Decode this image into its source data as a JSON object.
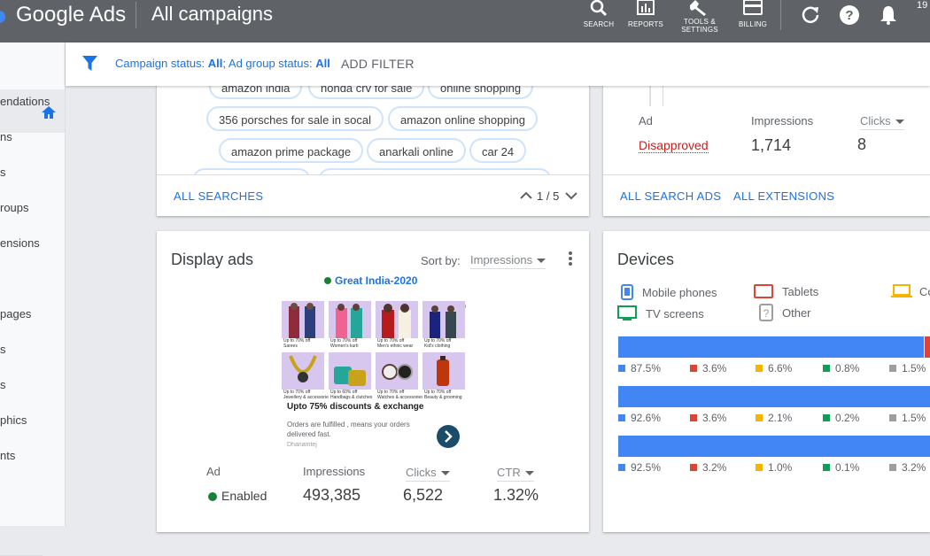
{
  "header": {
    "brand": "Google Ads",
    "title": "All campaigns",
    "tools": [
      {
        "label": "SEARCH",
        "icon": "search-icon"
      },
      {
        "label": "REPORTS",
        "icon": "reports-icon"
      },
      {
        "label_line1": "TOOLS &",
        "label_line2": "SETTINGS",
        "icon": "wrench-icon"
      },
      {
        "label": "BILLING",
        "icon": "billing-icon"
      }
    ],
    "account_fragment": "19"
  },
  "nav": {
    "items": [
      "endations",
      "ns",
      "s",
      "roups",
      "ensions",
      "pages",
      "s",
      "s",
      "phics",
      "nts"
    ]
  },
  "filter": {
    "campaign_label": "Campaign status: ",
    "campaign_value": "All",
    "sep": "; Ad group status: ",
    "adgroup_value": "All",
    "add_filter": "ADD FILTER"
  },
  "searches_card": {
    "chips": [
      {
        "text": "amazon india"
      },
      {
        "text": "honda crv for sale"
      },
      {
        "text": "online shopping"
      },
      {
        "text": "356 porsches for sale in socal"
      },
      {
        "text": "amazon online shopping"
      },
      {
        "text": "amazon prime package"
      },
      {
        "text": "anarkali online"
      },
      {
        "text": "car 24"
      }
    ],
    "link": "ALL SEARCHES",
    "pager": "1 / 5"
  },
  "search_ads_card": {
    "ad_label": "Ad",
    "status": "Disapproved",
    "impressions_label": "Impressions",
    "impressions": "1,714",
    "clicks_label": "Clicks",
    "clicks": "8",
    "link1": "ALL SEARCH ADS",
    "link2": "ALL EXTENSIONS"
  },
  "display_card": {
    "title": "Display ads",
    "sort_label": "Sort by:",
    "sort_value": "Impressions",
    "campaign": "Great India-2020",
    "ad": {
      "headline": "Upto 75% discounts & exchange",
      "body": "Orders are fulfilled , means your orders delivered fast.",
      "advertiser": "Dhanamtej",
      "thumb_captions": [
        "Up to 70% off",
        "Up to 70% off",
        "Up to 70% off",
        "Up to 70% off",
        "Up to 70% off",
        "Up to 60% off",
        "Up to 70% off",
        "Up to 70% off"
      ],
      "thumb_sub": [
        "Sarees",
        "Women's kurti",
        "Men's ethnic wear",
        "Kid's clothing",
        "Jewellery & accessories",
        "Handbags & clutches",
        "Watches & accessories",
        "Beauty & grooming"
      ]
    },
    "ad_label": "Ad",
    "status": "Enabled",
    "impressions_label": "Impressions",
    "impressions": "493,385",
    "clicks_label": "Clicks",
    "clicks": "6,522",
    "ctr_label": "CTR",
    "ctr": "1.32%"
  },
  "devices_card": {
    "title": "Devices",
    "legend": [
      {
        "label": "Mobile phones",
        "icon": "mobile-phone-icon"
      },
      {
        "label": "Tablets",
        "icon": "tablet-icon"
      },
      {
        "label": "Co",
        "icon": "computer-icon"
      },
      {
        "label": "TV screens",
        "icon": "tv-icon"
      },
      {
        "label": "Other",
        "icon": "other-device-icon"
      }
    ],
    "colors": {
      "mobile": "#4285f4",
      "tablet": "#db4437",
      "computer": "#f4b400",
      "tv": "#0f9d58",
      "other": "#9e9e9e"
    },
    "rows": [
      {
        "values": [
          87.5,
          3.6,
          6.6,
          0.8,
          1.5
        ],
        "labels": [
          "87.5%",
          "3.6%",
          "6.6%",
          "0.8%",
          "1.5%"
        ]
      },
      {
        "values": [
          92.6,
          3.6,
          2.1,
          0.2,
          1.5
        ],
        "labels": [
          "92.6%",
          "3.6%",
          "2.1%",
          "0.2%",
          "1.5%"
        ]
      },
      {
        "values": [
          92.5,
          3.2,
          1.0,
          0.1,
          3.2
        ],
        "labels": [
          "92.5%",
          "3.2%",
          "1.0%",
          "0.1%",
          "3.2%"
        ]
      }
    ]
  }
}
